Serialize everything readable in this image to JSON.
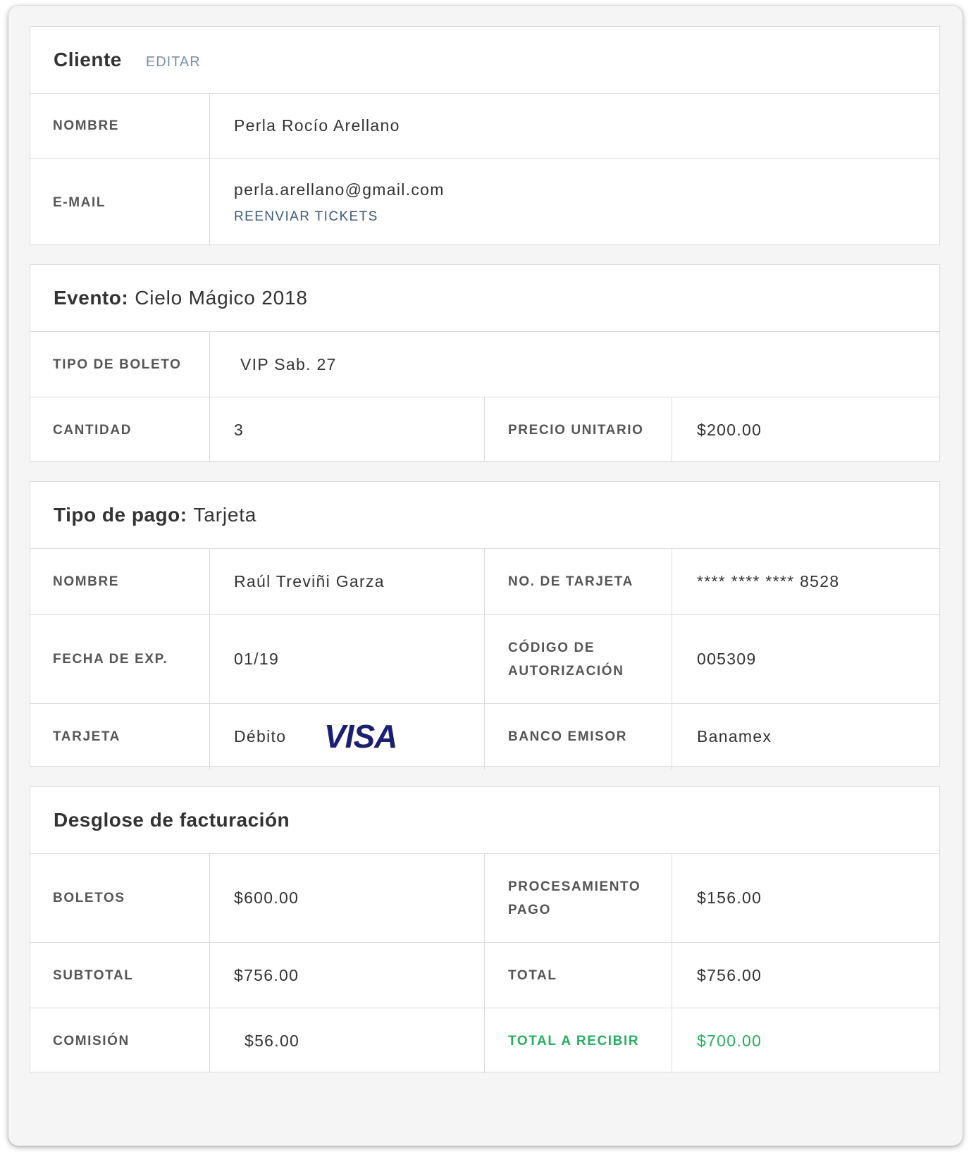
{
  "cliente": {
    "title": "Cliente",
    "edit_label": "EDITAR",
    "rows": {
      "nombre_label": "NOMBRE",
      "nombre_value": "Perla Rocío Arellano",
      "email_label": "E-MAIL",
      "email_value": "perla.arellano@gmail.com",
      "resend_label": "REENVIAR TICKETS"
    }
  },
  "evento": {
    "title": "Evento:",
    "name": "Cielo Mágico 2018",
    "tipo_label": "TIPO DE BOLETO",
    "tipo_value": "VIP Sab. 27",
    "cantidad_label": "CANTIDAD",
    "cantidad_value": "3",
    "precio_label": "PRECIO UNITARIO",
    "precio_value": "$200.00"
  },
  "pago": {
    "title": "Tipo de pago:",
    "tipo": "Tarjeta",
    "nombre_label": "NOMBRE",
    "nombre_value": "Raúl Treviñi Garza",
    "tarjeta_no_label": "NO. DE TARJETA",
    "tarjeta_no_value": "**** **** **** 8528",
    "fecha_label": "FECHA DE EXP.",
    "fecha_value": "01/19",
    "codigo_label": "CÓDIGO DE AUTORIZACIÓN",
    "codigo_value": "005309",
    "tarjeta_label": "TARJETA",
    "tarjeta_value": "Débito",
    "card_brand": "VISA",
    "banco_label": "BANCO EMISOR",
    "banco_value": "Banamex"
  },
  "facturacion": {
    "title": "Desglose de facturación",
    "boletos_label": "BOLETOS",
    "boletos_value": "$600.00",
    "procesamiento_label": "PROCESAMIENTO PAGO",
    "procesamiento_value": "$156.00",
    "subtotal_label": "SUBTOTAL",
    "subtotal_value": "$756.00",
    "total_label": "TOTAL",
    "total_value": "$756.00",
    "comision_label": "COMISIÓN",
    "comision_value": "$56.00",
    "recibir_label": "TOTAL A RECIBIR",
    "recibir_value": "$700.00"
  },
  "colors": {
    "accent_green": "#27ae60",
    "link_blue": "#3d5a7c",
    "edit_gray_blue": "#7b8fa8",
    "visa_blue": "#1a1f71",
    "visa_gold": "#f7a600"
  }
}
